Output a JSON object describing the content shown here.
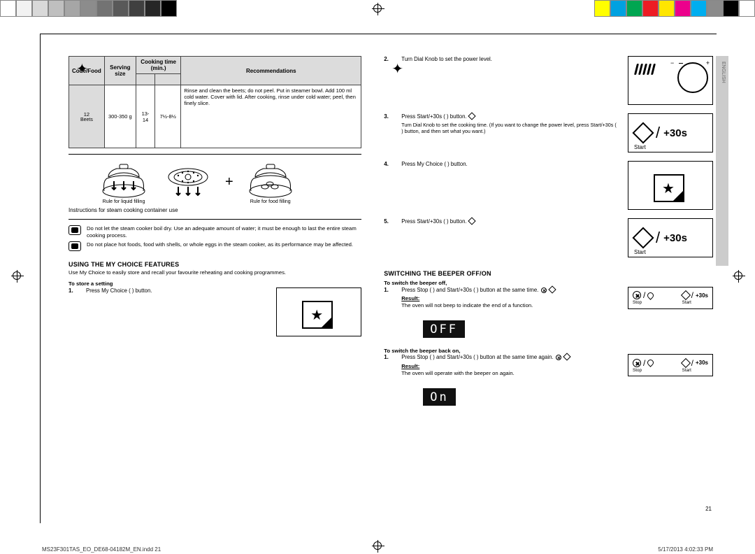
{
  "sidetab": "ENGLISH",
  "table": {
    "headers": [
      "Code/Food",
      "Serving size",
      "Cooking time (min.)",
      "Recommendations"
    ],
    "row": {
      "code": "12",
      "food": "Beets",
      "serving": "300-350 g",
      "time1": "13-14",
      "time2": "7½-8½",
      "rec": "Rinse and clean the beets; do not peel. Put in steamer bowl. Add 100 ml cold water. Cover with lid. After cooking, rinse under cold water; peel, then finely slice."
    }
  },
  "fig": {
    "cap1": "Rule for liquid filling",
    "cap2": "Rule for food filling"
  },
  "note_icon_caption": "Instructions for steam cooking container use",
  "tips": [
    "Do not let the steam cooker boil dry. Use an adequate amount of water; it must be enough to last the entire steam cooking process.",
    "Do not place hot foods, food with shells, or whole eggs in the steam cooker, as its performance may be affected."
  ],
  "fav": {
    "title": "USING THE MY CHOICE FEATURES",
    "intro": "Use My Choice to easily store and recall your favourite reheating and cooking programmes.",
    "store_h": "To store a setting",
    "s1": {
      "num": "1.",
      "text": "Press My Choice (  ) button."
    },
    "s2": {
      "num": "2.",
      "text": "Turn Dial Knob to set the power level."
    },
    "s3": {
      "num": "3.",
      "text": "Press Start/+30s (  ) button.",
      "note": "Turn Dial Knob to set the cooking time. (If you want to change the power level, press Start/+30s (  ) button, and then set what you want.)"
    },
    "s4": {
      "num": "4.",
      "text": "Press My Choice (  ) button."
    },
    "s5": {
      "num": "5.",
      "text": "Press Start/+30s (  ) button."
    }
  },
  "start_label": "Start",
  "plus30": "+30s",
  "beep": {
    "title": "SWITCHING THE BEEPER OFF/ON",
    "off_h": "To switch the beeper off,",
    "off_step": {
      "num": "1.",
      "text": "Press Stop (  ) and Start/+30s (  ) button at the same time.",
      "result_lbl": "Result:",
      "result": "The oven will not beep to indicate the end of a function."
    },
    "display_off": "OFF",
    "on_h": "To switch the beeper back on,",
    "on_step": {
      "num": "1.",
      "text": "Press Stop (  ) and Start/+30s (  ) button at the same time again.",
      "result_lbl": "Result:",
      "result": "The oven will operate with the beeper on again."
    },
    "display_on": "On"
  },
  "stop_lbl": "Stop",
  "page_num": "21",
  "footer": {
    "file": "MS23F301TAS_EO_DE68-04182M_EN.indd   21",
    "stamp": "5/17/2013   4:02:33 PM"
  },
  "colorbar_left": [
    "#fff",
    "#f2f2f2",
    "#d9d9d9",
    "#bfbfbf",
    "#a6a6a6",
    "#8c8c8c",
    "#737373",
    "#595959",
    "#404040",
    "#262626",
    "#000"
  ],
  "colorbar_right": [
    "#ffff00",
    "#00a1e0",
    "#00a651",
    "#ed1c24",
    "#ffe600",
    "#ec008c",
    "#00aeef",
    "#8b8b8b",
    "#000000",
    "#ffffff"
  ]
}
